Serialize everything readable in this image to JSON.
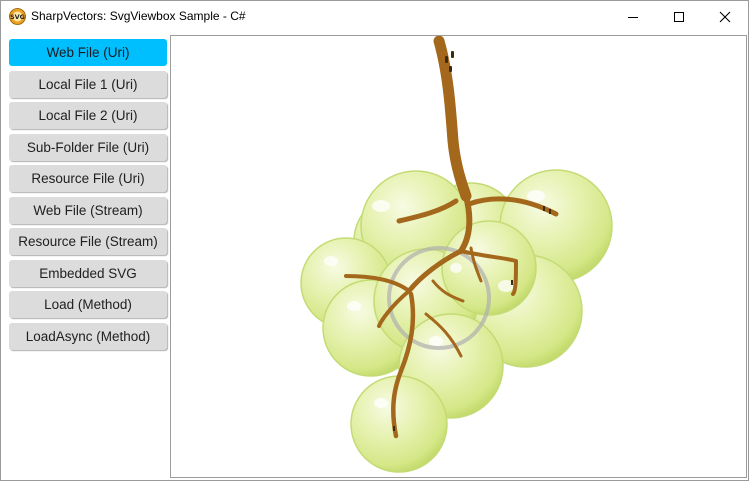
{
  "window": {
    "title": "SharpVectors: SvgViewbox Sample - C#",
    "app_icon": "svg-logo-icon",
    "controls": [
      "minimize-icon",
      "maximize-icon",
      "close-icon"
    ]
  },
  "sidebar": {
    "items": [
      {
        "label": "Web File (Uri)",
        "active": true
      },
      {
        "label": "Local File 1 (Uri)",
        "active": false
      },
      {
        "label": "Local File 2 (Uri)",
        "active": false
      },
      {
        "label": "Sub-Folder File (Uri)",
        "active": false
      },
      {
        "label": "Resource File (Uri)",
        "active": false
      },
      {
        "label": "Web File (Stream)",
        "active": false
      },
      {
        "label": "Resource File (Stream)",
        "active": false
      },
      {
        "label": "Embedded SVG",
        "active": false
      },
      {
        "label": "Load (Method)",
        "active": false
      },
      {
        "label": "LoadAsync (Method)",
        "active": false
      }
    ]
  },
  "viewer": {
    "image": "grapes-illustration",
    "colors": {
      "grape": "#d4e88a",
      "stem": "#a0691e",
      "accent": "#00bfff"
    }
  }
}
